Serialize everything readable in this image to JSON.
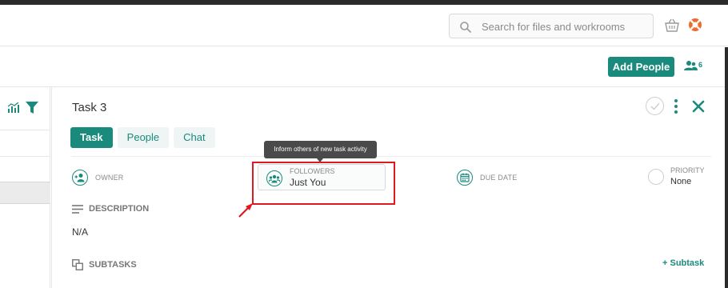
{
  "header": {
    "search_placeholder": "Search for files and workrooms",
    "icons": {
      "search": "search-icon",
      "basket": "basket-icon",
      "help": "lifebuoy-icon"
    }
  },
  "subbar": {
    "add_people_label": "Add People",
    "people_count": "6"
  },
  "task_panel": {
    "title": "Task 3",
    "tabs": [
      {
        "label": "Task",
        "active": true
      },
      {
        "label": "People",
        "active": false
      },
      {
        "label": "Chat",
        "active": false
      }
    ],
    "fields": {
      "owner_label": "OWNER",
      "followers_label": "FOLLOWERS",
      "followers_value": "Just You",
      "due_date_label": "DUE DATE",
      "priority_label": "PRIORITY",
      "priority_value": "None"
    },
    "description": {
      "label": "DESCRIPTION",
      "value": "N/A"
    },
    "subtasks": {
      "label": "SUBTASKS",
      "add_label": "+ Subtask"
    },
    "tooltip": "Inform others of new task activity"
  },
  "colors": {
    "accent": "#1a8a7d",
    "highlight": "#e0191f"
  }
}
